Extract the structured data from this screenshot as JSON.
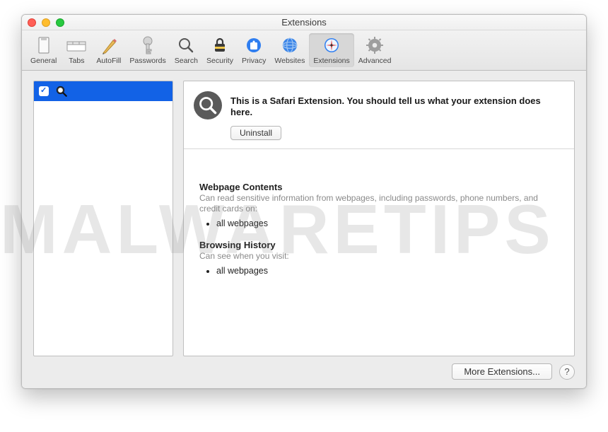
{
  "window": {
    "title": "Extensions"
  },
  "toolbar": {
    "items": [
      {
        "label": "General"
      },
      {
        "label": "Tabs"
      },
      {
        "label": "AutoFill"
      },
      {
        "label": "Passwords"
      },
      {
        "label": "Search"
      },
      {
        "label": "Security"
      },
      {
        "label": "Privacy"
      },
      {
        "label": "Websites"
      },
      {
        "label": "Extensions"
      },
      {
        "label": "Advanced"
      }
    ]
  },
  "detail": {
    "description": "This is a Safari Extension. You should tell us what your extension does here.",
    "uninstall_label": "Uninstall"
  },
  "permissions": {
    "section1_title": "Webpage Contents",
    "section1_sub": "Can read sensitive information from webpages, including passwords, phone numbers, and credit cards on:",
    "section1_item": "all webpages",
    "section2_title": "Browsing History",
    "section2_sub": "Can see when you visit:",
    "section2_item": "all webpages"
  },
  "footer": {
    "more_label": "More Extensions...",
    "help_label": "?"
  },
  "watermark": "MALWARETIPS"
}
